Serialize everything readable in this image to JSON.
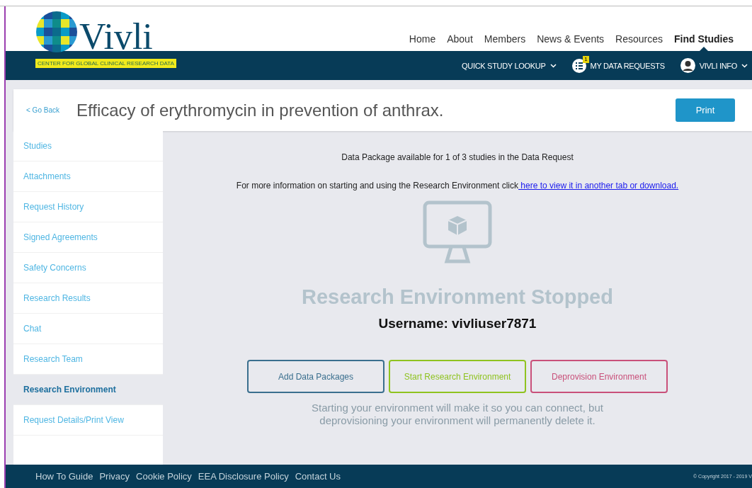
{
  "brand": {
    "name": "Vivli",
    "tagline": "CENTER FOR GLOBAL CLINICAL RESEARCH DATA"
  },
  "top_nav": [
    {
      "label": "Home",
      "selected": false
    },
    {
      "label": "About",
      "selected": false
    },
    {
      "label": "Members",
      "selected": false
    },
    {
      "label": "News & Events",
      "selected": false
    },
    {
      "label": "Resources",
      "selected": false
    },
    {
      "label": "Find Studies",
      "selected": true
    }
  ],
  "sub_nav": {
    "lookup": "QUICK STUDY LOOKUP",
    "requests": "MY DATA REQUESTS",
    "requests_badge": "1",
    "account": "VIVLI INFO"
  },
  "page_header": {
    "back": "< Go Back",
    "title": "Efficacy of erythromycin in prevention of anthrax.",
    "print": "Print"
  },
  "sidebar": {
    "items": [
      {
        "label": "Studies",
        "selected": false
      },
      {
        "label": "Attachments",
        "selected": false
      },
      {
        "label": "Request History",
        "selected": false
      },
      {
        "label": "Signed Agreements",
        "selected": false
      },
      {
        "label": "Safety Concerns",
        "selected": false
      },
      {
        "label": "Research Results",
        "selected": false
      },
      {
        "label": "Chat",
        "selected": false
      },
      {
        "label": "Research Team",
        "selected": false
      },
      {
        "label": "Research Environment",
        "selected": true
      },
      {
        "label": "Request Details/Print View",
        "selected": false
      }
    ]
  },
  "main": {
    "availability": "Data Package available for 1 of 3 studies in the Data Request",
    "info": "For more information on starting and using the Research Environment click",
    "info_link": " here to view it in another tab or download.",
    "status": "Research Environment Stopped",
    "username": "Username: vivliuser7871",
    "buttons": [
      {
        "label": "Add Data Packages",
        "kind": "neutral"
      },
      {
        "label": "Start Research Environment",
        "kind": "start"
      },
      {
        "label": "Deprovision Environment",
        "kind": "danger"
      }
    ],
    "note": "Starting your environment will make it so you can connect, but deprovisioning your environment will permanently delete it."
  },
  "footer": {
    "links": [
      "How To Guide",
      "Privacy",
      "Cookie Policy",
      "EEA Disclosure Policy",
      "Contact Us"
    ],
    "copyright": "© Copyright 2017 - 2019 V"
  }
}
